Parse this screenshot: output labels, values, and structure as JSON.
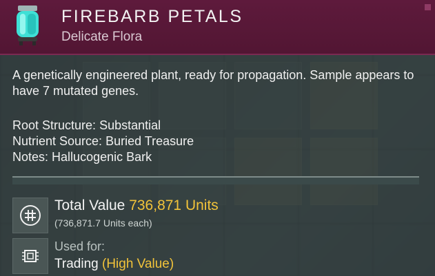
{
  "item": {
    "title": "FIREBARB PETALS",
    "category": "Delicate Flora",
    "icon": "specimen-canister-icon",
    "header_color": "#5e1a3c",
    "accent_color": "#f2c33a"
  },
  "description": "A genetically engineered plant, ready for propagation. Sample appears to have 7 mutated genes.",
  "properties": [
    {
      "label": "Root Structure:",
      "value": "Substantial"
    },
    {
      "label": "Nutrient Source:",
      "value": "Buried Treasure"
    },
    {
      "label": "Notes:",
      "value": "Hallucogenic Bark"
    }
  ],
  "value": {
    "label": "Total Value",
    "amount": "736,871 Units",
    "each": "(736,871.7 Units each)",
    "icon": "units-currency-icon"
  },
  "usage": {
    "label": "Used for:",
    "value": "Trading",
    "highlight": "(High Value)",
    "icon": "microchip-icon"
  }
}
